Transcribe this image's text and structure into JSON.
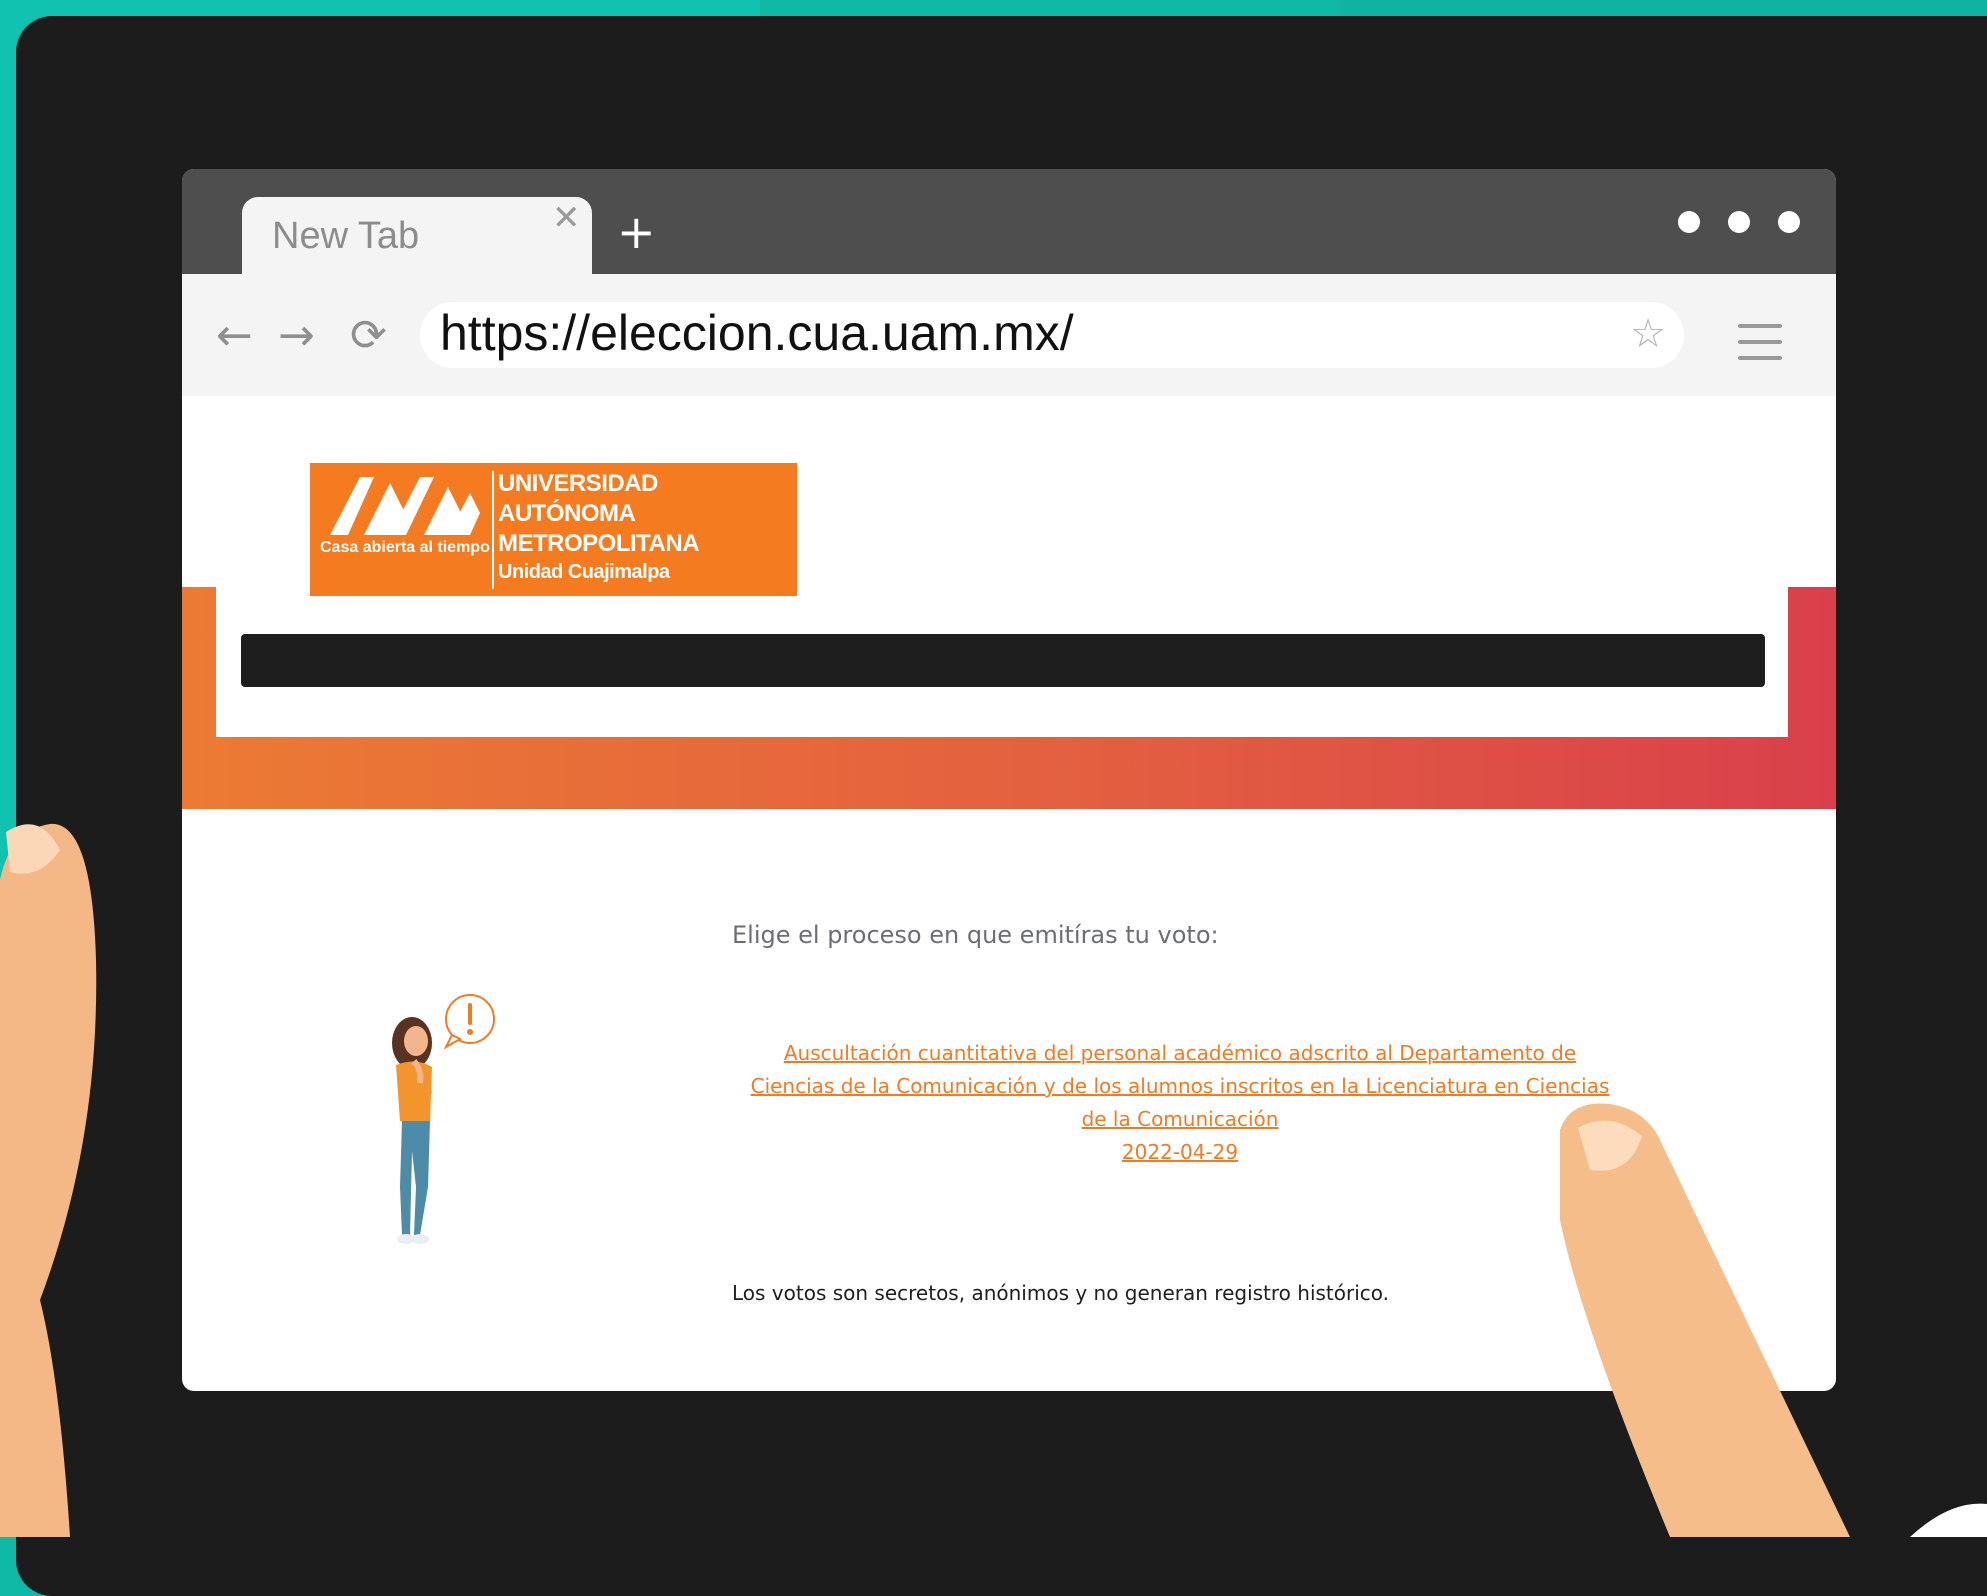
{
  "browser": {
    "tab_title": "New Tab",
    "tab_close_icon": "close-icon",
    "new_tab_icon": "plus-icon",
    "url": "https://eleccion.cua.uam.mx/",
    "icons": [
      "back-arrow-icon",
      "forward-arrow-icon",
      "reload-icon",
      "star-icon",
      "hamburger-menu-icon",
      "more-dots-icon"
    ]
  },
  "logo": {
    "tagline": "Casa abierta al tiempo",
    "line1": "UNIVERSIDAD",
    "line2": "AUTÓNOMA",
    "line3": "METROPOLITANA",
    "line4": "Unidad Cuajimalpa",
    "brand_color": "#f47b20"
  },
  "main": {
    "prompt": "Elige el proceso en que emitíras tu voto:",
    "election_link": {
      "line1": "Auscultación cuantitativa del personal académico adscrito al Departamento de",
      "line2": "Ciencias de la Comunicación y de los alumnos inscritos en la Licenciatura en Ciencias",
      "line3": "de la Comunicación",
      "date": "2022-04-29"
    },
    "footer_note": "Los votos son secretos, anónimos y no generan registro histórico."
  },
  "colors": {
    "accent": "#f07b23",
    "gradient_start": "#ec7a33",
    "gradient_end": "#d9404b",
    "background": "#10b8a6"
  }
}
